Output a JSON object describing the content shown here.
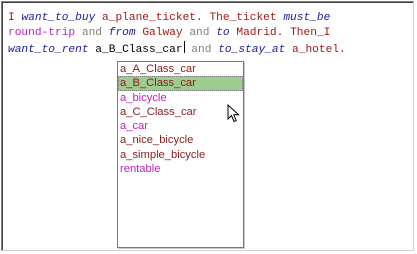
{
  "editor": {
    "line1": {
      "pre": " ",
      "t1": "I",
      "t2": "want_to_buy",
      "t3": "a_plane_ticket.",
      "t4": "The_ticket",
      "t5": "must_be"
    },
    "line2": {
      "t1": "round-trip",
      "t2": "and",
      "t3": "from",
      "t4": "Galway",
      "t5": "and",
      "t6": "to",
      "t7": "Madrid.",
      "t8": "Then_I"
    },
    "line3": {
      "t1": "want_to_rent",
      "t2": "a_B_Class_car",
      "t3": "and",
      "t4": "to_stay_at",
      "t5": "a_hotel."
    }
  },
  "autocomplete": {
    "items": [
      {
        "label": "a_A_Class_car"
      },
      {
        "label": "a_B_Class_car"
      },
      {
        "label": "a_bicycle"
      },
      {
        "label": "a_C_Class_car"
      },
      {
        "label": "a_car"
      },
      {
        "label": "a_nice_bicycle"
      },
      {
        "label": "a_simple_bicycle"
      },
      {
        "label": "rentable"
      }
    ],
    "selected_index": 1
  },
  "icons": {
    "mouse_pointer": "arrow-cursor-icon"
  },
  "colors": {
    "verb_phrase": "#2020a0",
    "noun_phrase": "#a01818",
    "connector": "#808080",
    "class_name": "#c020c0",
    "selected_bg": "#9ccc90"
  }
}
